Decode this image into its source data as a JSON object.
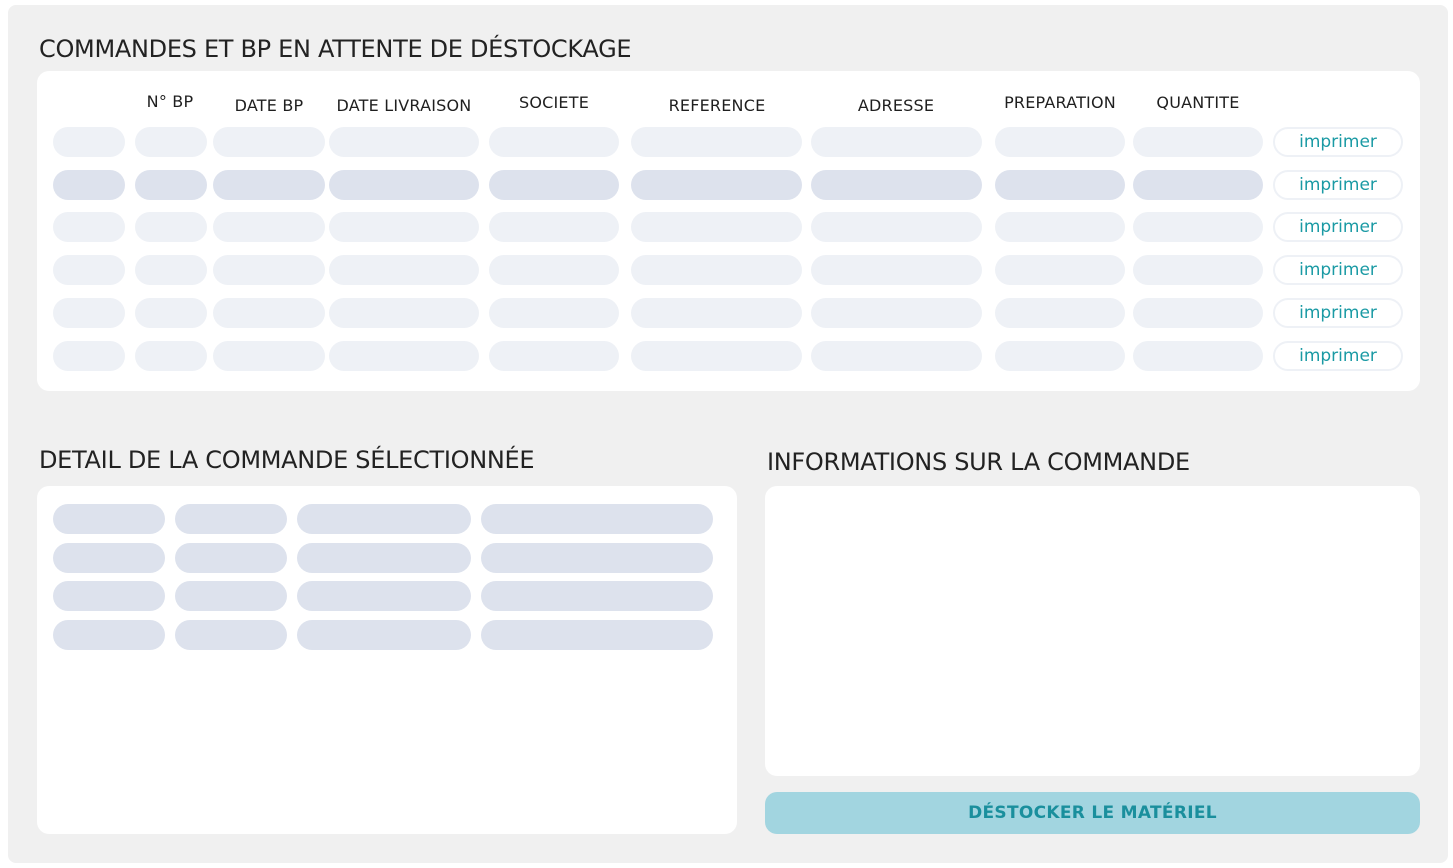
{
  "orders": {
    "title": "COMMANDES ET BP EN ATTENTE DE DÉSTOCKAGE",
    "columns": [
      "N° BP",
      "DATE BP",
      "DATE LIVRAISON",
      "SOCIETE",
      "REFERENCE",
      "ADRESSE",
      "PREPARATION",
      "QUANTITE"
    ],
    "print_label": "imprimer",
    "row_count": 6
  },
  "detail": {
    "title": "DETAIL DE LA COMMANDE SÉLECTIONNÉE"
  },
  "info": {
    "title": "INFORMATIONS SUR LA COMMANDE"
  },
  "destock_button": "DÉSTOCKER LE MATÉRIEL",
  "colors": {
    "background": "#f0f0f0",
    "card": "#ffffff",
    "placeholder_light": "#eef1f6",
    "placeholder_dark": "#dde2ed",
    "accent_text": "#1a9aa4",
    "button_bg": "#a2d5e0"
  }
}
